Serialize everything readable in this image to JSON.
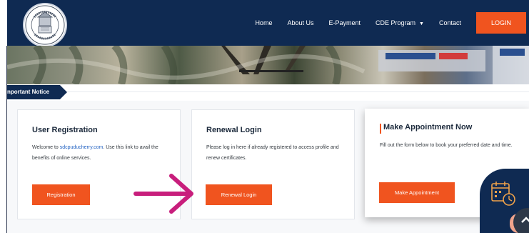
{
  "nav": {
    "links": [
      "Home",
      "About Us",
      "E-Payment",
      "CDE Program",
      "Contact"
    ],
    "login_label": "LOGIN"
  },
  "notice": {
    "label": "nportant Notice"
  },
  "cards": {
    "registration": {
      "title": "User Registration",
      "text_prefix": "Welcome to ",
      "link": "sdcpuducherry.com",
      "text_suffix": ". Use this link to avail the benefits of online services.",
      "button": "Registration"
    },
    "renewal": {
      "title": "Renewal Login",
      "text": "Please log in here if already registered to access profile and renew certificates.",
      "button": "Renewal Login"
    },
    "appointment": {
      "title": "Make Appointment Now",
      "text": "Fill out the form below to book your preferred date and time.",
      "button": "Make Appointment"
    }
  },
  "colors": {
    "navy": "#0f2a52",
    "accent_orange": "#f0541f",
    "arrow_magenta": "#c81e7c",
    "link_blue": "#1e5fc1"
  },
  "icons": [
    "logo-seal-icon",
    "chevron-down-icon",
    "arrow-right-annotation-icon",
    "calendar-clock-icon",
    "scroll-up-icon"
  ]
}
